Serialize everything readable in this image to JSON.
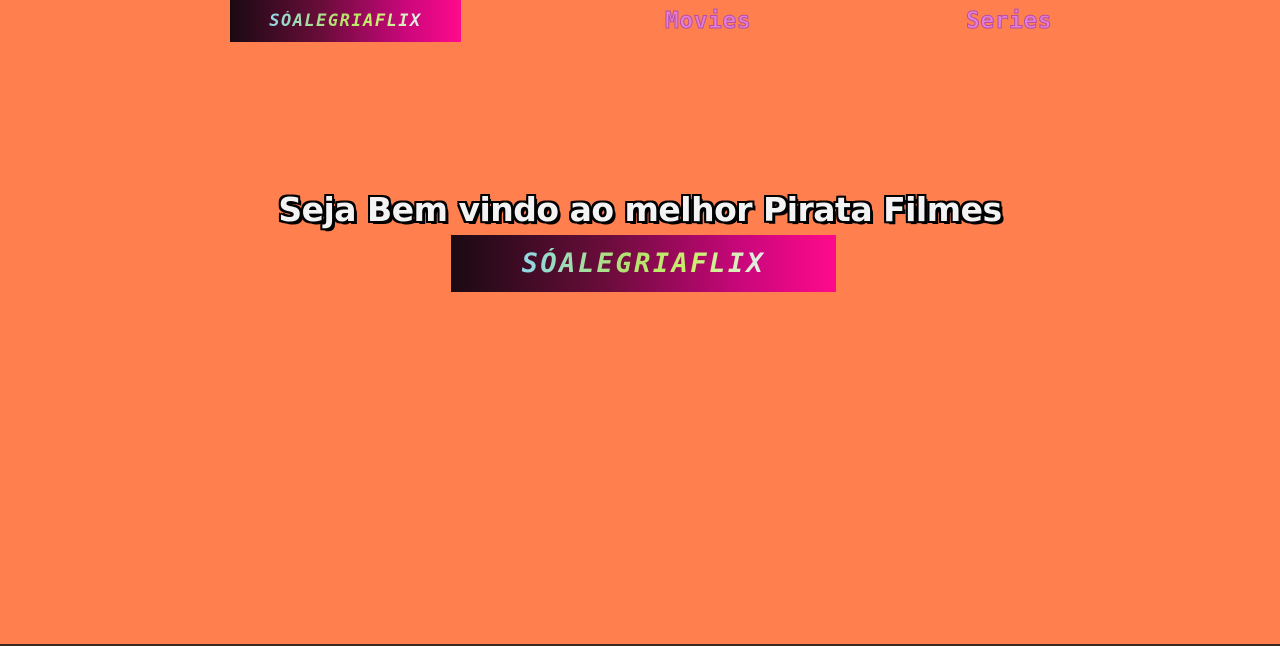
{
  "header": {
    "logo_text": "SÓALEGRIAFLIX",
    "nav": [
      {
        "label": "Movies"
      },
      {
        "label": "Series"
      }
    ]
  },
  "hero": {
    "title": "Seja Bem vindo ao melhor Pirata Filmes",
    "logo_text": "SÓALEGRIAFLIX"
  },
  "colors": {
    "background": "#ff7f4f",
    "nav_link": "#e57fd6",
    "logo_gradient_start": "#1a0a12",
    "logo_gradient_end": "#ff0a8c"
  }
}
